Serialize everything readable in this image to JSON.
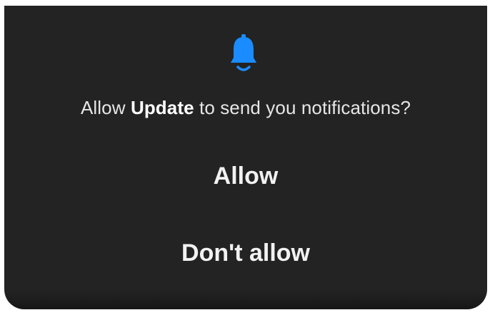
{
  "dialog": {
    "icon": "bell-icon",
    "message_prefix": "Allow ",
    "app_name": "Update",
    "message_suffix": " to send you notifications?",
    "allow_label": "Allow",
    "deny_label": "Don't allow"
  },
  "colors": {
    "background": "#232323",
    "accent": "#1a8cff",
    "text": "#e6e6e6"
  }
}
